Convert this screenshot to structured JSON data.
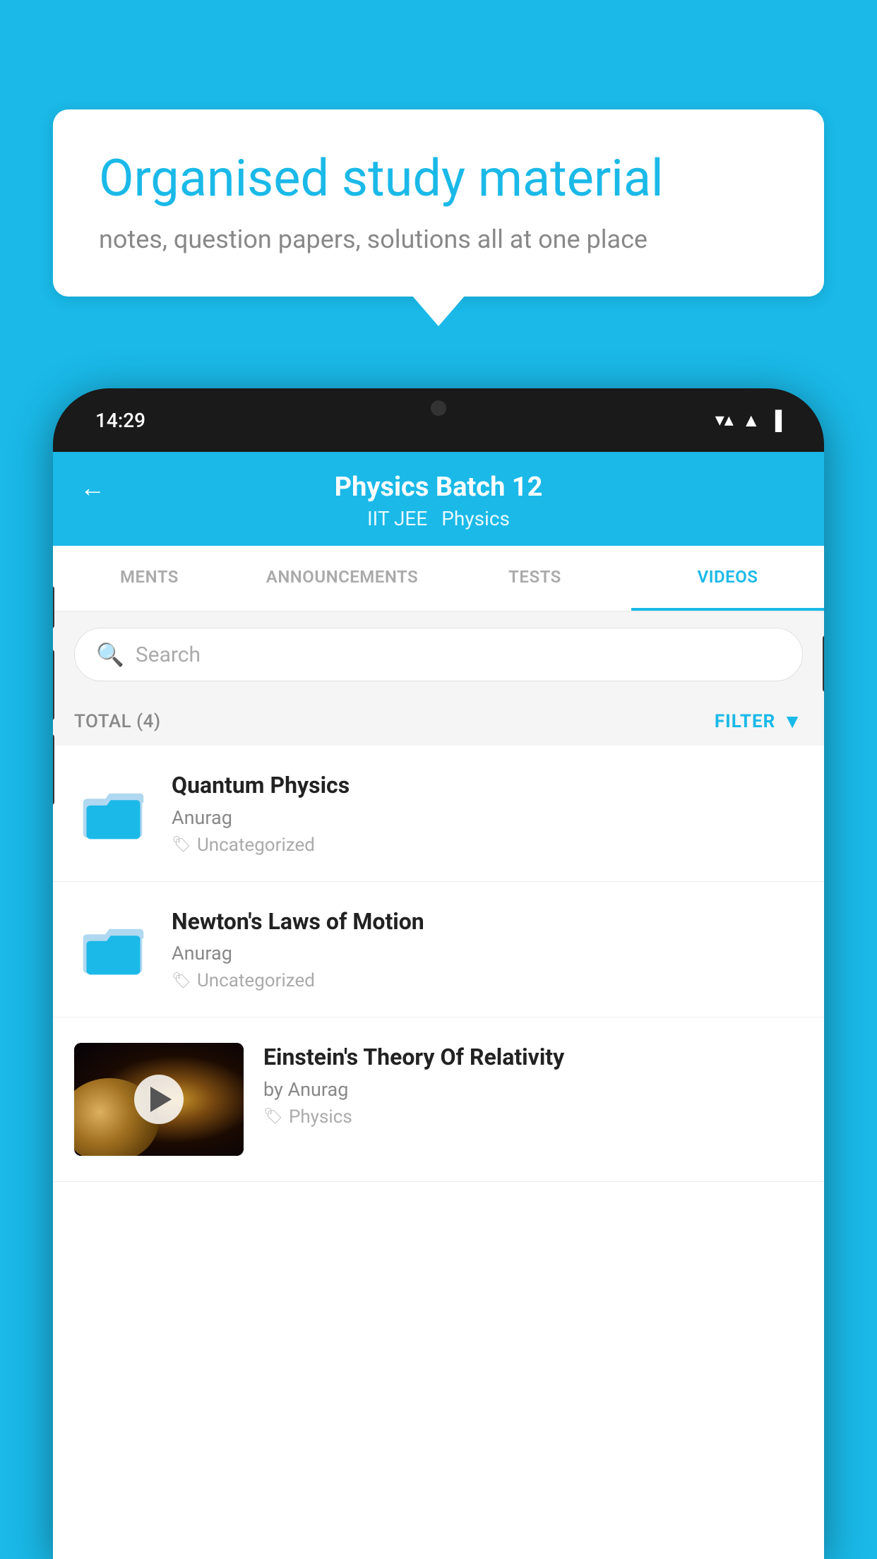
{
  "background_color": "#1ab9e8",
  "speech_bubble": {
    "title": "Organised study material",
    "subtitle": "notes, question papers, solutions all at one place"
  },
  "status_bar": {
    "time": "14:29",
    "wifi": "▼▲",
    "signal": "▲",
    "battery": "▌"
  },
  "app_header": {
    "back_label": "←",
    "title": "Physics Batch 12",
    "subtitle_left": "IIT JEE",
    "subtitle_right": "Physics"
  },
  "tabs": [
    {
      "label": "MENTS",
      "active": false
    },
    {
      "label": "ANNOUNCEMENTS",
      "active": false
    },
    {
      "label": "TESTS",
      "active": false
    },
    {
      "label": "VIDEOS",
      "active": true
    }
  ],
  "search": {
    "placeholder": "Search"
  },
  "filter_row": {
    "total_label": "TOTAL (4)",
    "filter_label": "FILTER"
  },
  "videos": [
    {
      "id": 1,
      "title": "Quantum Physics",
      "author": "Anurag",
      "tag": "Uncategorized",
      "type": "folder"
    },
    {
      "id": 2,
      "title": "Newton's Laws of Motion",
      "author": "Anurag",
      "tag": "Uncategorized",
      "type": "folder"
    },
    {
      "id": 3,
      "title": "Einstein's Theory Of Relativity",
      "author": "by Anurag",
      "tag": "Physics",
      "type": "video"
    }
  ]
}
